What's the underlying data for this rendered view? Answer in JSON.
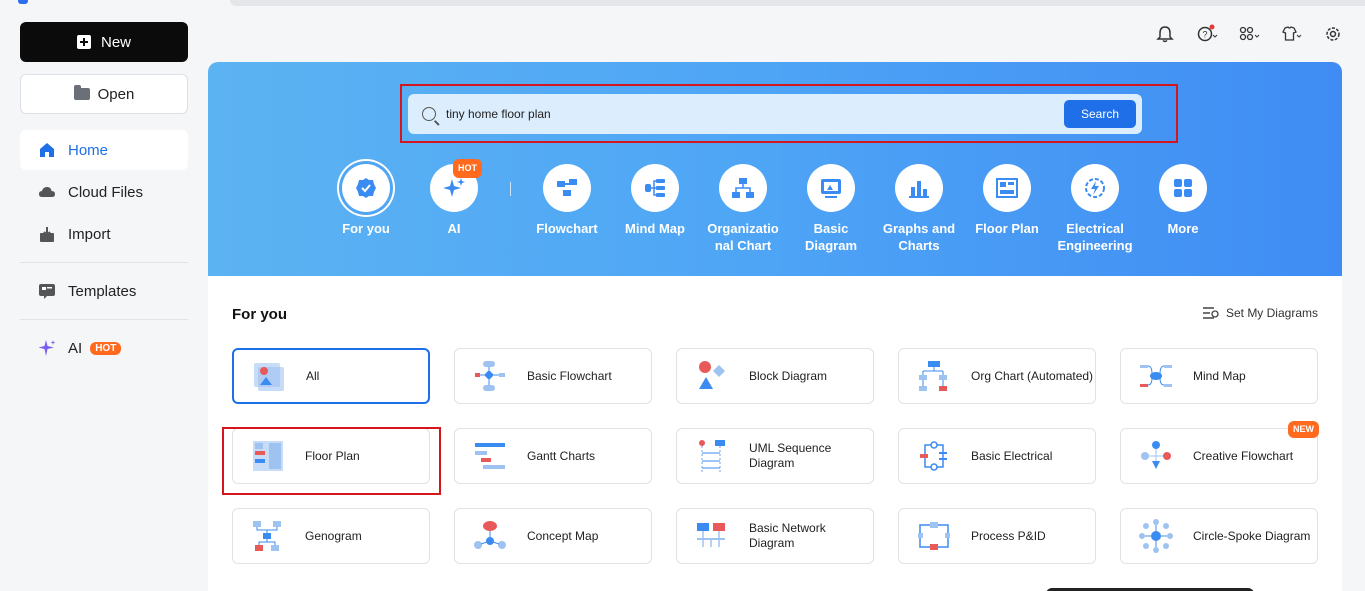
{
  "sidebar": {
    "new_label": "New",
    "open_label": "Open",
    "items": [
      {
        "label": "Home",
        "icon": "home-icon"
      },
      {
        "label": "Cloud Files",
        "icon": "cloud-icon"
      },
      {
        "label": "Import",
        "icon": "import-icon"
      },
      {
        "label": "Templates",
        "icon": "templates-icon"
      },
      {
        "label": "AI",
        "icon": "ai-sparkle-icon",
        "badge": "HOT"
      }
    ]
  },
  "search": {
    "value": "tiny home floor plan",
    "button": "Search"
  },
  "categories": [
    {
      "label": "For you",
      "selected": true
    },
    {
      "label": "AI",
      "badge": "HOT"
    },
    {
      "label": "Flowchart"
    },
    {
      "label": "Mind Map"
    },
    {
      "label": "Organizatio nal Chart"
    },
    {
      "label": "Basic Diagram"
    },
    {
      "label": "Graphs and Charts"
    },
    {
      "label": "Floor Plan"
    },
    {
      "label": "Electrical Engineering"
    },
    {
      "label": "More"
    }
  ],
  "section": {
    "title": "For you",
    "set_label": "Set My Diagrams"
  },
  "cards": [
    {
      "label": "All",
      "selected": true
    },
    {
      "label": "Basic Flowchart"
    },
    {
      "label": "Block Diagram"
    },
    {
      "label": "Org Chart (Automated)"
    },
    {
      "label": "Mind Map"
    },
    {
      "label": "Floor Plan"
    },
    {
      "label": "Gantt Charts"
    },
    {
      "label": "UML Sequence Diagram"
    },
    {
      "label": "Basic Electrical"
    },
    {
      "label": "Creative Flowchart",
      "badge": "NEW"
    },
    {
      "label": "Genogram"
    },
    {
      "label": "Concept Map"
    },
    {
      "label": "Basic Network Diagram"
    },
    {
      "label": "Process P&ID"
    },
    {
      "label": "Circle-Spoke Diagram"
    }
  ],
  "colors": {
    "accent": "#1e6fe8",
    "hot": "#ff6a1f",
    "highlight": "#d6161f"
  }
}
